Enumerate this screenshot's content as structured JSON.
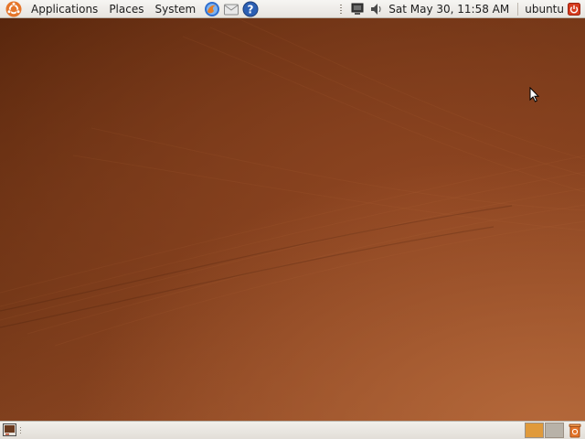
{
  "top_panel": {
    "menus": [
      "Applications",
      "Places",
      "System"
    ],
    "clock": "Sat May 30, 11:58 AM",
    "user": "ubuntu",
    "launchers": [
      "firefox-icon",
      "mail-icon",
      "help-icon"
    ],
    "tray": [
      "network-icon",
      "volume-icon"
    ]
  },
  "bottom_panel": {
    "workspaces": [
      "Workspace 1",
      "Workspace 2"
    ],
    "active_workspace": 1
  },
  "colors": {
    "accent": "#e09a3b",
    "desktop_dark": "#4c1f08",
    "desktop_light": "#b4683a",
    "power_red": "#d63b1f"
  }
}
